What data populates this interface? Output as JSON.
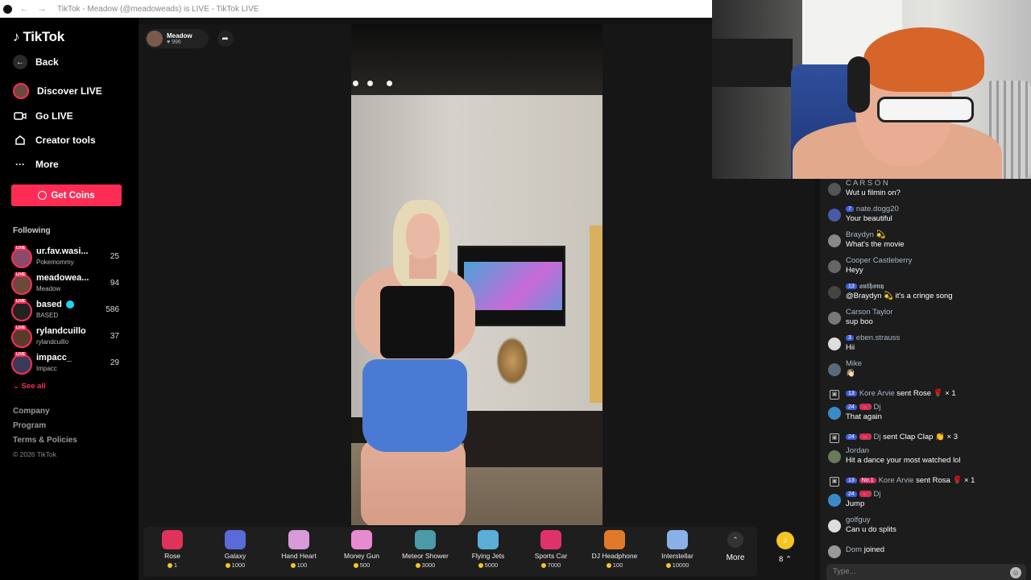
{
  "browser": {
    "title": "TikTok - Meadow (@meadoweads) is LIVE - TikTok LIVE"
  },
  "sidebar": {
    "logo_text": "TikTok",
    "back_label": "Back",
    "nav": [
      {
        "label": "Discover LIVE",
        "icon": "avatar-icon"
      },
      {
        "label": "Go LIVE",
        "icon": "video-camera-icon"
      },
      {
        "label": "Creator tools",
        "icon": "house-icon"
      },
      {
        "label": "More",
        "icon": "ellipsis-icon"
      }
    ],
    "get_coins": "Get Coins",
    "following_title": "Following",
    "following": [
      {
        "name": "ur.fav.wasi...",
        "sub": "Pokemommy",
        "count": "25",
        "color": "#8a4a6a"
      },
      {
        "name": "meadowea...",
        "sub": "Meadow",
        "count": "94",
        "color": "#6a4a3a"
      },
      {
        "name": "based",
        "sub": "BASED",
        "count": "586",
        "color": "#222222",
        "verified": true
      },
      {
        "name": "rylandcuillo",
        "sub": "rylandcuillo",
        "count": "37",
        "color": "#5a3a2a"
      },
      {
        "name": "impacc_",
        "sub": "Impacc",
        "count": "29",
        "color": "#3a3a5a"
      }
    ],
    "see_all": "See all",
    "footer": [
      "Company",
      "Program",
      "Terms & Policies"
    ],
    "copyright": "© 2026 TikTok"
  },
  "streamer": {
    "name": "Meadow",
    "views": "996"
  },
  "gifts": [
    {
      "name": "Rose",
      "price": "1",
      "color": "#e0325a"
    },
    {
      "name": "Galaxy",
      "price": "1000",
      "color": "#5a6ad8"
    },
    {
      "name": "Hand Heart",
      "price": "100",
      "color": "#d89ad8"
    },
    {
      "name": "Money Gun",
      "price": "500",
      "color": "#e88ad0"
    },
    {
      "name": "Meteor Shower",
      "price": "3000",
      "color": "#4a9aa8"
    },
    {
      "name": "Flying Jets",
      "price": "5000",
      "color": "#5aaed8"
    },
    {
      "name": "Sports Car",
      "price": "7000",
      "color": "#e0326a"
    },
    {
      "name": "DJ Headphone",
      "price": "100",
      "color": "#e07a2a"
    },
    {
      "name": "Interstellar",
      "price": "10000",
      "color": "#8ab0e8"
    }
  ],
  "gift_more": "More",
  "coin_count": "8",
  "chat": {
    "messages": [
      {
        "type": "msg",
        "user": "C A R S O N",
        "text": "Wut u filmin on?",
        "avatar": "#555555"
      },
      {
        "type": "msg",
        "user": "nate.dogg20",
        "badge": "7",
        "text": "Your beautiful",
        "avatar": "#4a5aa8"
      },
      {
        "type": "msg",
        "user": "Braydyn 💫",
        "text": "What's the movie",
        "avatar": "#888888"
      },
      {
        "type": "msg",
        "user": "Cooper Castleberry",
        "text": "Heyy",
        "avatar": "#666666"
      },
      {
        "type": "msg",
        "user": "𝖆𝖚𝖙𝖍𝖔𝖓𝖞",
        "badge": "13",
        "text": "@Braydyn 💫 it's a cringe song",
        "avatar": "#444444"
      },
      {
        "type": "msg",
        "user": "Carson Taylor",
        "text": "sup boo",
        "avatar": "#777777"
      },
      {
        "type": "msg",
        "user": "eben.strauss",
        "badge": "3",
        "text": "Hii",
        "avatar": "#dddddd"
      },
      {
        "type": "msg",
        "user": "Mike",
        "text": "👋🏻",
        "avatar": "#5a6a7a"
      },
      {
        "type": "gift",
        "user": "Kore Arvie",
        "badge": "13",
        "text": "sent Rose 🌹 × 1"
      },
      {
        "type": "msg",
        "user": "Dj",
        "badge": "24",
        "badge2": "💗",
        "text": "That again",
        "avatar": "#3a8ac8"
      },
      {
        "type": "gift",
        "user": "Dj",
        "badge": "24",
        "badge2": "💗",
        "text": "sent Clap Clap 👏 × 3"
      },
      {
        "type": "msg",
        "user": "Jordan",
        "text": "Hit a dance your most watched lol",
        "avatar": "#6a7a5a"
      },
      {
        "type": "gift",
        "user": "Kore Arvie",
        "badge": "13",
        "badge3": "No.1",
        "text": "sent Rosa 🌹 × 1"
      },
      {
        "type": "msg",
        "user": "Dj",
        "badge": "24",
        "badge2": "💗",
        "text": "Jump",
        "avatar": "#3a8ac8"
      },
      {
        "type": "msg",
        "user": "golfguy",
        "text": "Can u do splits",
        "avatar": "#dddddd"
      },
      {
        "type": "join",
        "user": "Dom",
        "text": "joined"
      }
    ],
    "input_placeholder": "Type..."
  }
}
